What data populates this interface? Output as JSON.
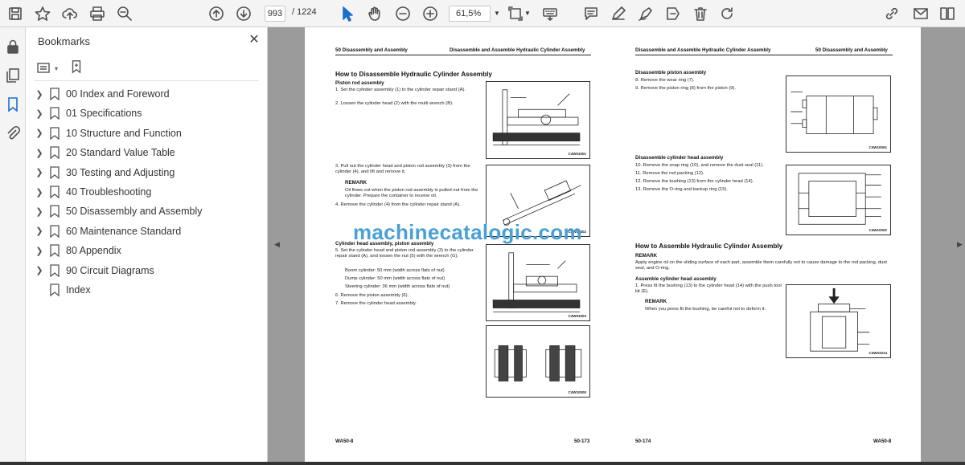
{
  "toolbar": {
    "page_current": "993",
    "page_total": "/ 1224",
    "zoom": "61,5%"
  },
  "bookmarks_panel": {
    "title": "Bookmarks",
    "items": [
      {
        "label": "00 Index and Foreword"
      },
      {
        "label": "01 Specifications"
      },
      {
        "label": "10 Structure and Function"
      },
      {
        "label": "20 Standard Value Table"
      },
      {
        "label": "30 Testing and Adjusting"
      },
      {
        "label": "40 Troubleshooting"
      },
      {
        "label": "50 Disassembly and Assembly"
      },
      {
        "label": "60 Maintenance Standard"
      },
      {
        "label": "80 Appendix"
      },
      {
        "label": "90 Circuit Diagrams"
      },
      {
        "label": "Index"
      }
    ]
  },
  "left_page": {
    "header_left": "50 Disassembly and Assembly",
    "header_right": "Disassemble and Assemble Hydraulic Cylinder Assembly",
    "title": "How to Disassemble Hydraulic Cylinder Assembly",
    "sub1": "Piston rod assembly",
    "s1": "1.  Set the cylinder assembly (1) to the cylinder repair stand (A).",
    "s2": "2.  Loosen the cylinder head (2) with the multi wrench (B).",
    "s3": "3.  Pull out the cylinder head and piston rod assembly (3) from the cylinder (4), and lift and remove it.",
    "remark1": "REMARK",
    "remark1_text": "Oil flows out when the piston rod assembly is pulled out from the cylinder. Prepare the container to receive oil.",
    "s4": "4.  Remove the cylinder (4) from the cylinder repair stand (A).",
    "sub2": "Cylinder head assembly, piston assembly",
    "s5": "5.  Set the cylinder head and piston rod assembly (3) to the cylinder repair stand (A), and loosen the nut (5) with the wrench (G).",
    "boom": "Boom cylinder: 50 mm (width across flats of nut)",
    "dump": "Dump cylinder: 50 mm (width across flats of nut)",
    "steer": "Steering cylinder: 36 mm (width across flats of nut)",
    "s6": "6.  Remove the piston assembly (6).",
    "s7": "7.  Remove the cylinder head assembly.",
    "fig1": "C4W03301",
    "fig2": "C4W03302",
    "fig3": "C4W03303",
    "fig4": "C4W10000",
    "footer_left": "WA50-8",
    "footer_right": "50-173"
  },
  "right_page": {
    "header_left": "Disassemble and Assemble Hydraulic Cylinder Assembly",
    "header_right": "50 Disassembly and Assembly",
    "sub1": "Disassemble piston assembly",
    "s8": "8.  Remove the wear ring (7).",
    "s9": "9.  Remove the piston ring (8) from the piston (9).",
    "sub2": "Disassemble cylinder head assembly",
    "s10": "10.  Remove the snap ring (10), and remove the dust seal (11).",
    "s11": "11.  Remove the rod packing (12).",
    "s12": "12.  Remove the bushing (13) from the cylinder head (14).",
    "s13": "13.  Remove the O-ring and backup ring (15).",
    "title2": "How to Assemble Hydraulic Cylinder Assembly",
    "remark1": "REMARK",
    "remark1_text": "Apply engine oil on the sliding surface of each part, assemble them carefully not to cause damage to the rod packing, dust seal, and O-ring.",
    "sub3": "Assemble cylinder head assembly",
    "a1": "1.  Press fit the bushing (13) to the cylinder head (14) with the push tool kit (E).",
    "remark2": "REMARK",
    "remark2_text": "When you press fit the bushing, be careful not to deform it.",
    "fig1": "C4W10001",
    "fig2": "C4W10002",
    "fig3": "C4W03314",
    "footer_left": "50-174",
    "footer_right": "WA50-8"
  },
  "watermark": "machinecatalogic.com"
}
